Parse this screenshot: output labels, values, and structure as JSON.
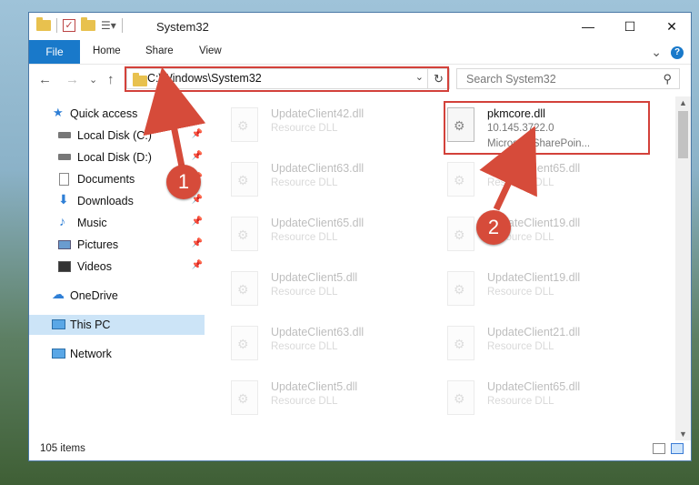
{
  "window": {
    "title": "System32",
    "controls": {
      "minimize": "—",
      "maximize": "☐",
      "close": "✕"
    }
  },
  "ribbon": {
    "file_tab": "File",
    "tabs": [
      "Home",
      "Share",
      "View"
    ],
    "expand_glyph": "⌄",
    "help_glyph": "?"
  },
  "nav": {
    "back": "←",
    "forward": "→",
    "dropdown": "⌄",
    "up": "↑",
    "address": "C:\\Windows\\System32",
    "address_dropdown": "⌄",
    "refresh": "↻",
    "search_placeholder": "Search System32",
    "search_icon": "⚲"
  },
  "sidebar": {
    "items": [
      {
        "label": "Quick access",
        "icon": "star-icon",
        "pinned": false
      },
      {
        "label": "Local Disk (C:)",
        "icon": "drive-icon",
        "pinned": true
      },
      {
        "label": "Local Disk (D:)",
        "icon": "drive-icon",
        "pinned": true
      },
      {
        "label": "Documents",
        "icon": "documents-icon",
        "pinned": true
      },
      {
        "label": "Downloads",
        "icon": "download-icon",
        "pinned": true
      },
      {
        "label": "Music",
        "icon": "music-icon",
        "pinned": true
      },
      {
        "label": "Pictures",
        "icon": "pictures-icon",
        "pinned": true
      },
      {
        "label": "Videos",
        "icon": "videos-icon",
        "pinned": true
      },
      {
        "label": "OneDrive",
        "icon": "cloud-icon",
        "pinned": false
      },
      {
        "label": "This PC",
        "icon": "computer-icon",
        "pinned": false,
        "selected": true
      },
      {
        "label": "Network",
        "icon": "network-icon",
        "pinned": false
      }
    ],
    "pin_glyph": "📌"
  },
  "files": {
    "highlighted": {
      "name": "pkmcore.dll",
      "version": "10.145.3722.0",
      "company": "Microsoft SharePoin..."
    },
    "faded": [
      {
        "name": "UpdateClient42.dll",
        "desc": "Resource DLL"
      },
      {
        "name": "UpdateClient63.dll",
        "desc": "Resource DLL"
      },
      {
        "name": "UpdateClient65.dll",
        "desc": "Resource DLL"
      },
      {
        "name": "UpdateClient65.dll",
        "desc": "Resource DLL"
      },
      {
        "name": "UpdateClient19.dll",
        "desc": "Resource DLL"
      },
      {
        "name": "UpdateClient5.dll",
        "desc": "Resource DLL"
      },
      {
        "name": "UpdateClient19.dll",
        "desc": "Resource DLL"
      },
      {
        "name": "UpdateClient63.dll",
        "desc": "Resource DLL"
      },
      {
        "name": "UpdateClient21.dll",
        "desc": "Resource DLL"
      },
      {
        "name": "UpdateClient5.dll",
        "desc": "Resource DLL"
      },
      {
        "name": "UpdateClient65.dll",
        "desc": "Resource DLL"
      }
    ]
  },
  "status": {
    "item_count": "105 items"
  },
  "annotations": {
    "step1": "1",
    "step2": "2",
    "color": "#d3413a"
  }
}
